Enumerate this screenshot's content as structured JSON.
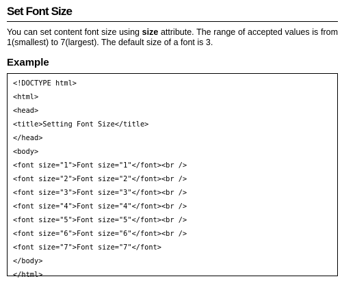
{
  "section": {
    "title": "Set Font Size",
    "intro_before": "You can set content font size using ",
    "intro_bold": "size",
    "intro_after": " attribute. The range of accepted values is from 1(smallest) to 7(largest). The default size of a font is 3."
  },
  "example": {
    "heading": "Example",
    "code_lines": [
      "<!DOCTYPE html>",
      "<html>",
      "<head>",
      "<title>Setting Font Size</title>",
      "</head>",
      "<body>",
      "<font size=\"1\">Font size=\"1\"</font><br />",
      "<font size=\"2\">Font size=\"2\"</font><br />",
      "<font size=\"3\">Font size=\"3\"</font><br />",
      "<font size=\"4\">Font size=\"4\"</font><br />",
      "<font size=\"5\">Font size=\"5\"</font><br />",
      "<font size=\"6\">Font size=\"6\"</font><br />",
      "<font size=\"7\">Font size=\"7\"</font>",
      "</body>",
      "</html>"
    ]
  }
}
